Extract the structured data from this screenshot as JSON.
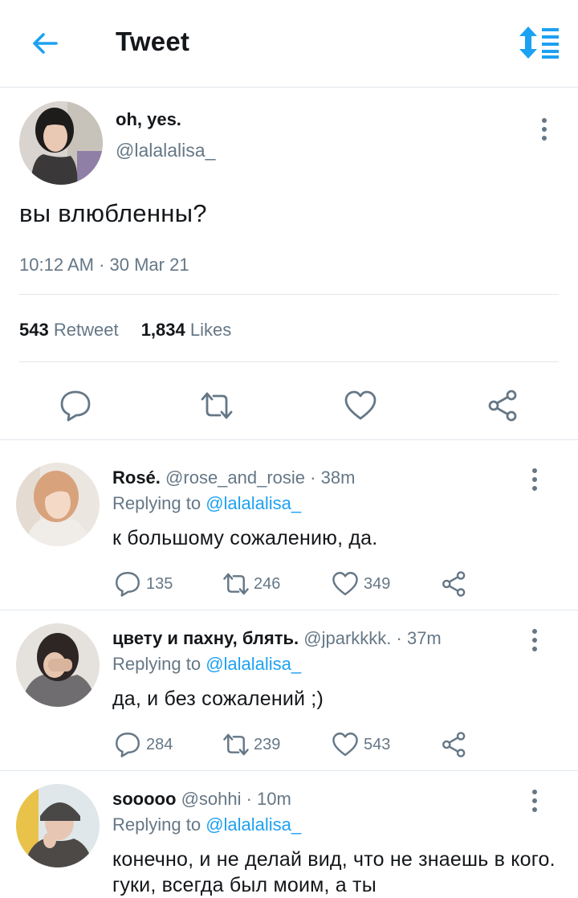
{
  "header": {
    "title": "Tweet",
    "back_icon": "back-arrow-icon",
    "sort_icon": "sort-icon"
  },
  "colors": {
    "accent": "#1da1f2",
    "secondary_text": "#657786",
    "divider": "#e1e8ed",
    "text": "#14171a"
  },
  "tweet": {
    "name": "oh, yes.",
    "handle": "@lalalalisa_",
    "text": "вы влюбленны?",
    "timestamp": "10:12 AM · 30 Mar 21",
    "retweet_count": "543",
    "retweet_label": "Retweet",
    "like_count": "1,834",
    "like_label": "Likes"
  },
  "replies": [
    {
      "name": "Rosé.",
      "handle": "@rose_and_rosie",
      "time": " · 38m",
      "replying_label": "Replying to ",
      "replying_to": "@lalalalisa_",
      "text": "к большому сожалению, да.",
      "comments": "135",
      "retweets": "246",
      "likes": "349"
    },
    {
      "name": "цвету и пахну, блять.",
      "handle": "@jparkkkk.",
      "time": " · 37m",
      "replying_label": "Replying to ",
      "replying_to": "@lalalalisa_",
      "text": "да, и без сожалений ;)",
      "comments": "284",
      "retweets": "239",
      "likes": "543"
    },
    {
      "name": "sooooo",
      "handle": "@sohhi",
      "time": " · 10m",
      "replying_label": "Replying to ",
      "replying_to": "@lalalalisa_",
      "text": "конечно, и не делай вид, что не знаешь в кого. гуки, всегда был моим, а ты"
    }
  ]
}
